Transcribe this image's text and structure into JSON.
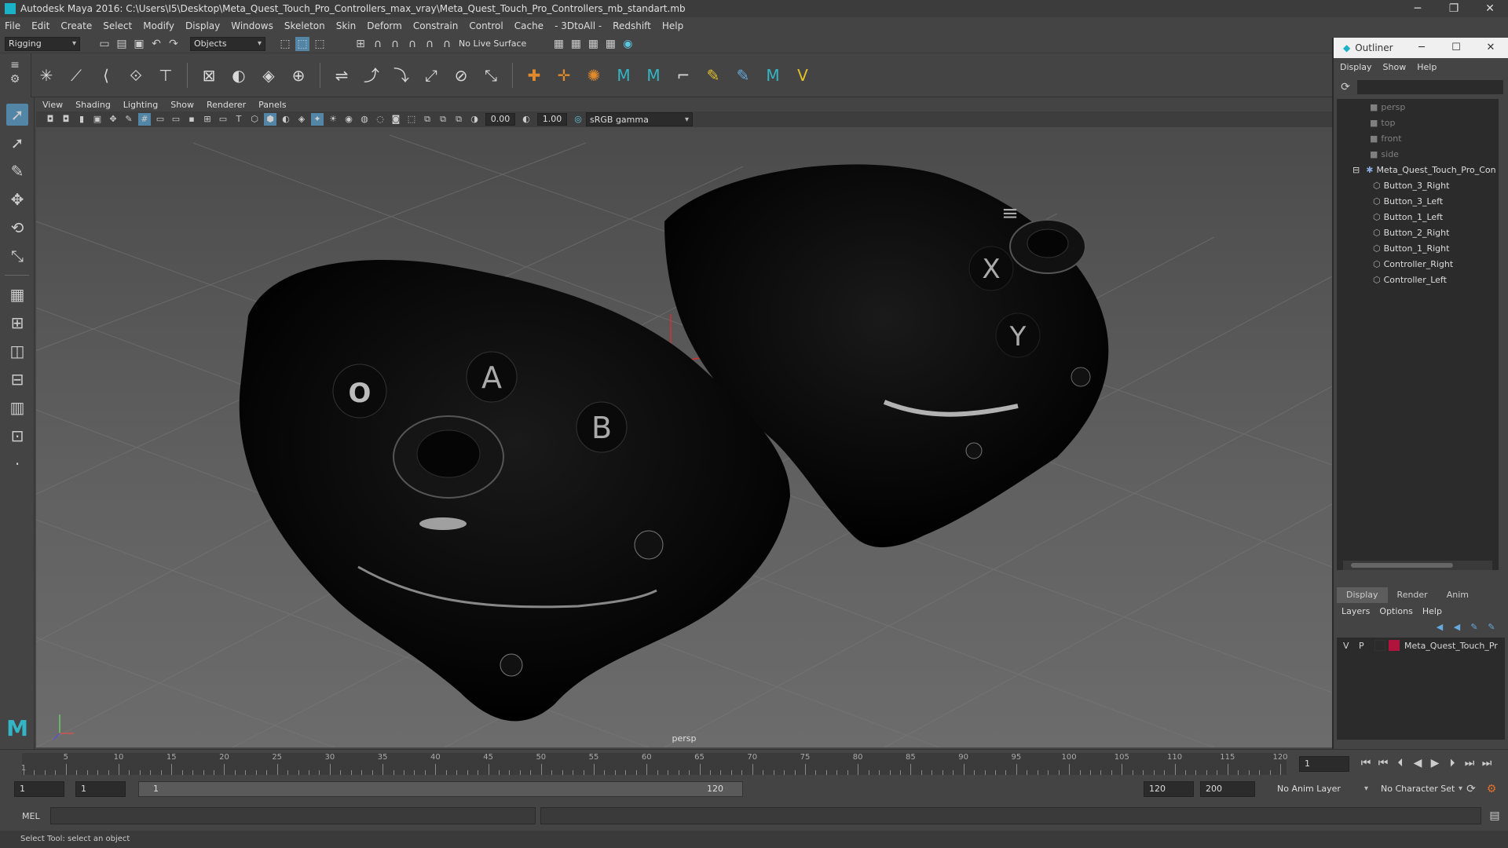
{
  "window": {
    "title": "Autodesk Maya 2016: C:\\Users\\I5\\Desktop\\Meta_Quest_Touch_Pro_Controllers_max_vray\\Meta_Quest_Touch_Pro_Controllers_mb_standart.mb"
  },
  "menu": [
    "File",
    "Edit",
    "Create",
    "Select",
    "Modify",
    "Display",
    "Windows",
    "Skeleton",
    "Skin",
    "Deform",
    "Constrain",
    "Control",
    "Cache",
    "- 3DtoAll -",
    "Redshift",
    "Help"
  ],
  "status": {
    "mode": "Rigging",
    "select_mode": "Objects",
    "live_surface": "No Live Surface"
  },
  "panel": {
    "menu": [
      "View",
      "Shading",
      "Lighting",
      "Show",
      "Renderer",
      "Panels"
    ],
    "exposure": "0.00",
    "gamma": "1.00",
    "color_space": "sRGB gamma"
  },
  "viewport": {
    "camera_label": "persp",
    "buttons_right": [
      "X",
      "Y",
      "≡"
    ],
    "buttons_left": [
      "O",
      "A",
      "B"
    ]
  },
  "outliner": {
    "title": "Outliner",
    "menu": [
      "Display",
      "Show",
      "Help"
    ],
    "cameras": [
      "persp",
      "top",
      "front",
      "side"
    ],
    "group": "Meta_Quest_Touch_Pro_Con",
    "children": [
      "Button_3_Right",
      "Button_3_Left",
      "Button_1_Left",
      "Button_2_Right",
      "Button_1_Right",
      "Controller_Right",
      "Controller_Left"
    ]
  },
  "layers": {
    "tabs": [
      "Display",
      "Render",
      "Anim"
    ],
    "menu": [
      "Layers",
      "Options",
      "Help"
    ],
    "row": {
      "v": "V",
      "p": "P",
      "name": "Meta_Quest_Touch_Pr",
      "color": "#b0143c"
    }
  },
  "timeline": {
    "ticks": [
      5,
      10,
      15,
      20,
      25,
      30,
      35,
      40,
      45,
      50,
      55,
      60,
      65,
      70,
      75,
      80,
      85,
      90,
      95,
      100,
      105,
      110,
      115,
      120
    ],
    "start_marker": "1",
    "current_frame": "1"
  },
  "range": {
    "start": "1",
    "inner_start": "1",
    "slider_start": "1",
    "slider_end": "120",
    "end": "120",
    "max": "200",
    "anim_layer": "No Anim Layer",
    "char_set": "No Character Set"
  },
  "cmd": {
    "label": "MEL"
  },
  "help": {
    "text": "Select Tool: select an object"
  }
}
